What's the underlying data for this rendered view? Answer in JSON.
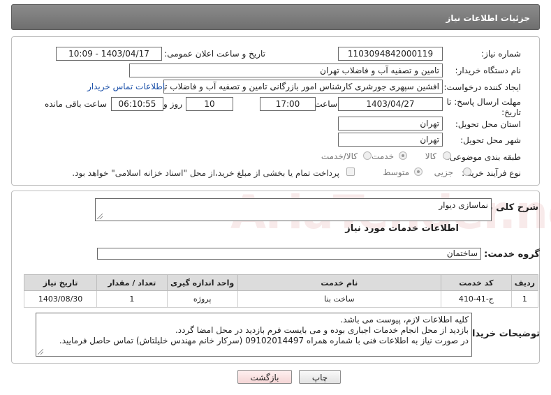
{
  "header": {
    "title": "جزئیات اطلاعات نیاز"
  },
  "need_number": {
    "label": "شماره نیاز:",
    "value": "1103094842000119"
  },
  "announce": {
    "label": "تاریخ و ساعت اعلان عمومی:",
    "value": "1403/04/17 - 10:09"
  },
  "buyer_org": {
    "label": "نام دستگاه خریدار:",
    "value": "تامین و تصفیه آب و فاضلاب تهران"
  },
  "requester": {
    "label": "ایجاد کننده درخواست:",
    "value": "افشین سپهری جورشری کارشناس امور بازرگانی تامین و تصفیه آب و فاضلاب تهران",
    "contact_link": "اطلاعات تماس خریدار"
  },
  "deadline": {
    "label_line1": "مهلت ارسال پاسخ: تا",
    "label_line2": "تاریخ:",
    "date": "1403/04/27",
    "time_label": "ساعت",
    "time": "17:00",
    "days": "10",
    "days_label": "روز و",
    "remaining": "06:10:55",
    "remaining_label": "ساعت باقی مانده"
  },
  "province": {
    "label": "استان محل تحویل:",
    "value": "تهران"
  },
  "city": {
    "label": "شهر محل تحویل:",
    "value": "تهران"
  },
  "category": {
    "label": "طبقه بندی موضوعی:",
    "options": [
      "کالا",
      "خدمت",
      "کالا/خدمت"
    ],
    "selected": "خدمت"
  },
  "process": {
    "label": "نوع فرآیند خرید :",
    "options": [
      "جزیی",
      "متوسط"
    ],
    "selected": "متوسط",
    "payment_note": "پرداخت تمام یا بخشی از مبلغ خرید،از محل \"اسناد خزانه اسلامی\" خواهد بود."
  },
  "description": {
    "label": "شرح کلی نیاز:",
    "value": "نماسازی دیوار"
  },
  "services_section": {
    "title": "اطلاعات خدمات مورد نیاز"
  },
  "service_group": {
    "label": "گروه خدمت:",
    "value": "ساختمان"
  },
  "table": {
    "headers": [
      "ردیف",
      "کد خدمت",
      "نام خدمت",
      "واحد اندازه گیری",
      "تعداد / مقدار",
      "تاریخ نیاز"
    ],
    "rows": [
      [
        "1",
        "ج-41-410",
        "ساخت بنا",
        "پروژه",
        "1",
        "1403/08/30"
      ]
    ]
  },
  "buyer_notes": {
    "label": "توضیحات خریدار:",
    "lines": [
      "کلیه اطلاعات لازم، پیوست می باشد.",
      "بازدید از محل انجام خدمات اجباری بوده و می بایست فرم بازدید در محل امضا گردد.",
      "در صورت نیاز به اطلاعات فنی با شماره همراه 09102014497 (سرکار خانم مهندس خلیلتاش) تماس حاصل فرمایید."
    ]
  },
  "buttons": {
    "print": "چاپ",
    "back": "بازگشت"
  },
  "watermark": {
    "text": "AriaTender.neT"
  },
  "colors": {
    "header": "#7a7a7a",
    "link": "#1a4fa8",
    "back_button": "#f4d5d5"
  }
}
